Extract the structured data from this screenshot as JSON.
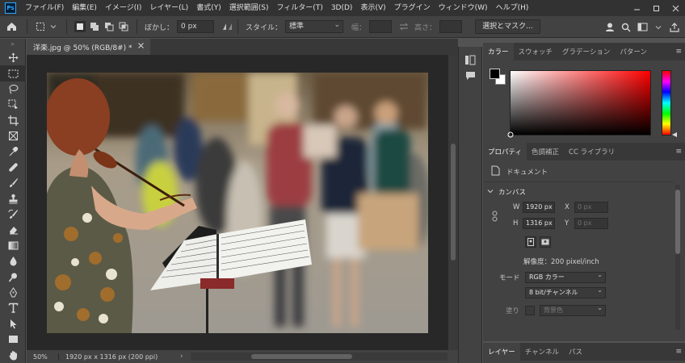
{
  "app": {
    "logo": "Ps",
    "menu": [
      "ファイル(F)",
      "編集(E)",
      "イメージ(I)",
      "レイヤー(L)",
      "書式(Y)",
      "選択範囲(S)",
      "フィルター(T)",
      "3D(D)",
      "表示(V)",
      "プラグイン",
      "ウィンドウ(W)",
      "ヘルプ(H)"
    ]
  },
  "options": {
    "feather_label": "ぼかし：",
    "feather_value": "0 px",
    "style_label": "スタイル：",
    "style_value": "標準",
    "width_label": "幅：",
    "height_label": "高さ：",
    "select_mask_button": "選択とマスク..."
  },
  "document": {
    "tab_title": "洋楽.jpg @ 50% (RGB/8#) *",
    "zoom": "50%",
    "info": "1920 px x 1316 px (200 ppi)"
  },
  "color_panel": {
    "tabs": [
      "カラー",
      "スウォッチ",
      "グラデーション",
      "パターン"
    ],
    "fg_color": "#000000",
    "bg_color": "#ffffff",
    "hue_color": "#ff0000"
  },
  "properties_panel": {
    "tabs": [
      "プロパティ",
      "色調補正",
      "CC ライブラリ"
    ],
    "kind": "ドキュメント",
    "section": "カンバス",
    "w_label": "W",
    "w_value": "1920 px",
    "h_label": "H",
    "h_value": "1316 px",
    "x_label": "X",
    "x_value": "0 px",
    "y_label": "Y",
    "y_value": "0 px",
    "resolution": "解像度：200 pixel/inch",
    "mode_label": "モード",
    "mode_value": "RGB カラー",
    "bit_value": "8 bit/チャンネル",
    "fill_label": "塗り",
    "fill_value": "背景色"
  },
  "layers_panel": {
    "tabs": [
      "レイヤー",
      "チャンネル",
      "パス"
    ]
  }
}
